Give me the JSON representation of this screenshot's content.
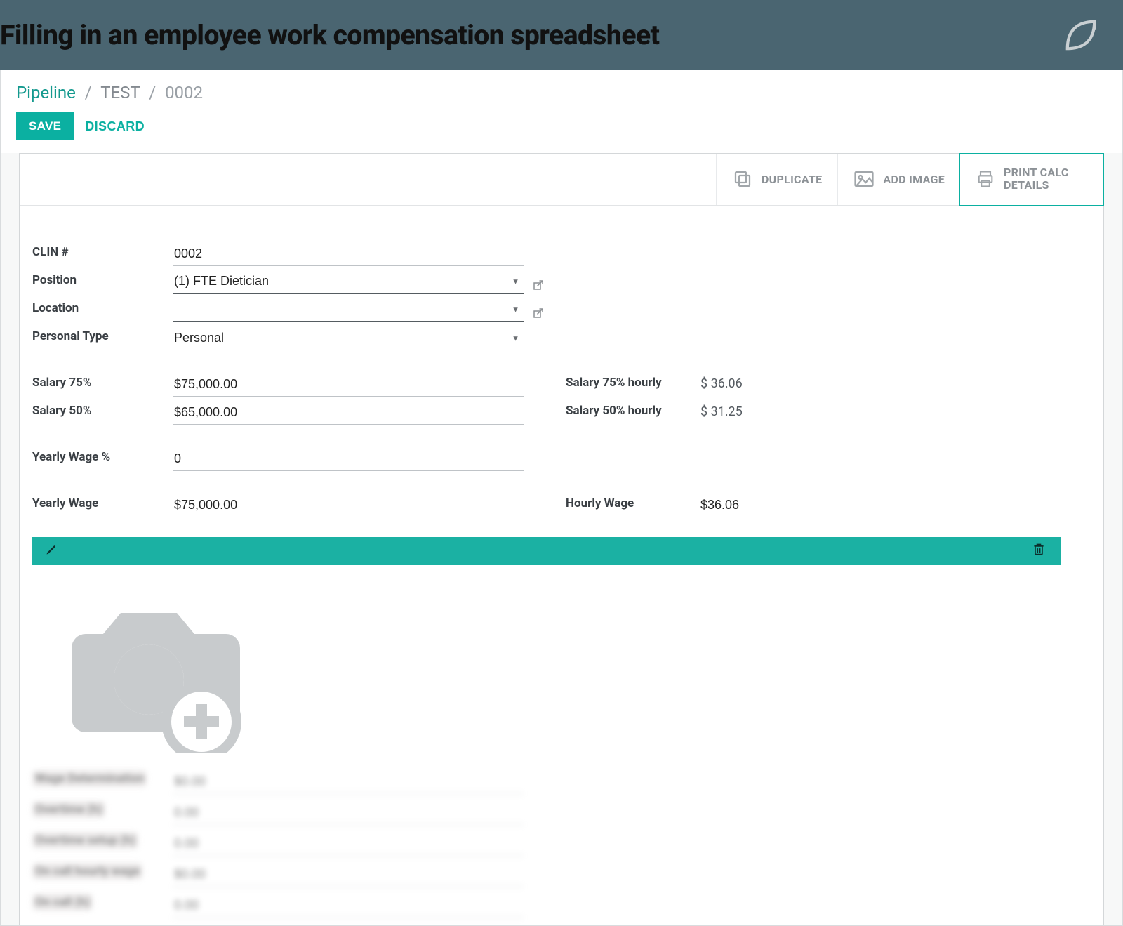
{
  "header": {
    "title": "Filling in an employee work compensation spreadsheet"
  },
  "breadcrumb": {
    "root": "Pipeline",
    "mid": "TEST",
    "leaf": "0002"
  },
  "actions": {
    "save": "SAVE",
    "discard": "DISCARD"
  },
  "tabs": {
    "duplicate": "DUPLICATE",
    "add_image": "ADD IMAGE",
    "print": "PRINT CALC DETAILS"
  },
  "form": {
    "clin_label": "CLIN #",
    "clin_value": "0002",
    "position_label": "Position",
    "position_value": "(1) FTE Dietician",
    "location_label": "Location",
    "location_value": "",
    "ptype_label": "Personal Type",
    "ptype_value": "Personal",
    "salary75_label": "Salary 75%",
    "salary75_value": "$75,000.00",
    "salary50_label": "Salary 50%",
    "salary50_value": "$65,000.00",
    "salary75h_label": "Salary 75% hourly",
    "salary75h_value": "$ 36.06",
    "salary50h_label": "Salary 50% hourly",
    "salary50h_value": "$ 31.25",
    "ywpct_label": "Yearly Wage %",
    "ywpct_value": "0",
    "yw_label": "Yearly Wage",
    "yw_value": "$75,000.00",
    "hw_label": "Hourly Wage",
    "hw_value": "$36.06"
  },
  "blurred": {
    "r1_label": "Wage Determination",
    "r1_value": "$0.00",
    "r2_label": "Overtime (h)",
    "r2_value": "0.00",
    "r3_label": "Overtime setup (h)",
    "r3_value": "0.00",
    "r4_label": "On call hourly wage",
    "r4_value": "$0.00",
    "r5_label": "On call (h)",
    "r5_value": "0.00"
  }
}
